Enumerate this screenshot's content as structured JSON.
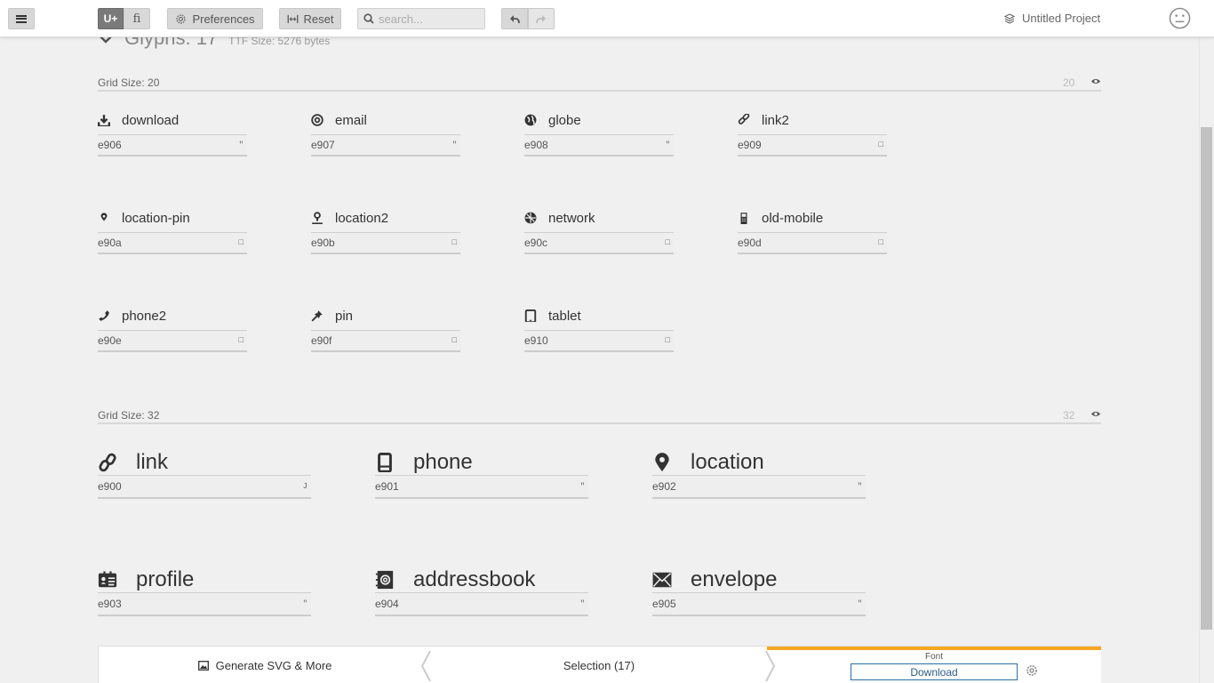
{
  "toolbar": {
    "uplus_label": "U+",
    "fi_label": "fi",
    "preferences_label": "Preferences",
    "reset_label": "Reset",
    "search_placeholder": "search...",
    "project_name": "Untitled Project"
  },
  "header": {
    "title": "Glyphs: 17",
    "ttf_size": "TTF Size: 5276 bytes"
  },
  "grid20": {
    "label": "Grid Size: 20",
    "size_value": "20",
    "glyphs": [
      {
        "name": "download",
        "code": "e906",
        "char": "″",
        "icon": "download-icon"
      },
      {
        "name": "email",
        "code": "e907",
        "char": "″",
        "icon": "at-icon"
      },
      {
        "name": "globe",
        "code": "e908",
        "char": "″",
        "icon": "globe-icon"
      },
      {
        "name": "link2",
        "code": "e909",
        "char": "□",
        "icon": "link-icon"
      },
      {
        "name": "location-pin",
        "code": "e90a",
        "char": "□",
        "icon": "location-pin-icon"
      },
      {
        "name": "location2",
        "code": "e90b",
        "char": "□",
        "icon": "location-person-icon"
      },
      {
        "name": "network",
        "code": "e90c",
        "char": "□",
        "icon": "network-icon"
      },
      {
        "name": "old-mobile",
        "code": "e90d",
        "char": "□",
        "icon": "old-mobile-icon"
      },
      {
        "name": "phone2",
        "code": "e90e",
        "char": "□",
        "icon": "phone-handset-icon"
      },
      {
        "name": "pin",
        "code": "e90f",
        "char": "□",
        "icon": "pushpin-icon"
      },
      {
        "name": "tablet",
        "code": "e910",
        "char": "□",
        "icon": "tablet-icon"
      }
    ]
  },
  "grid32": {
    "label": "Grid Size: 32",
    "size_value": "32",
    "glyphs": [
      {
        "name": "link",
        "code": "e900",
        "char": "J",
        "icon": "chain-link-icon"
      },
      {
        "name": "phone",
        "code": "e901",
        "char": "″",
        "icon": "mobile-phone-icon"
      },
      {
        "name": "location",
        "code": "e902",
        "char": "″",
        "icon": "map-marker-icon"
      },
      {
        "name": "profile",
        "code": "e903",
        "char": "″",
        "icon": "id-card-icon"
      },
      {
        "name": "addressbook",
        "code": "e904",
        "char": "″",
        "icon": "address-book-icon"
      },
      {
        "name": "envelope",
        "code": "e905",
        "char": "″",
        "icon": "envelope-icon"
      }
    ]
  },
  "bottom": {
    "generate_label": "Generate SVG & More",
    "selection_label": "Selection (17)",
    "font_label": "Font",
    "download_label": "Download"
  },
  "colors": {
    "accent": "#f5a623",
    "download_border": "#2a6fa8",
    "background": "#f0f0f0"
  }
}
